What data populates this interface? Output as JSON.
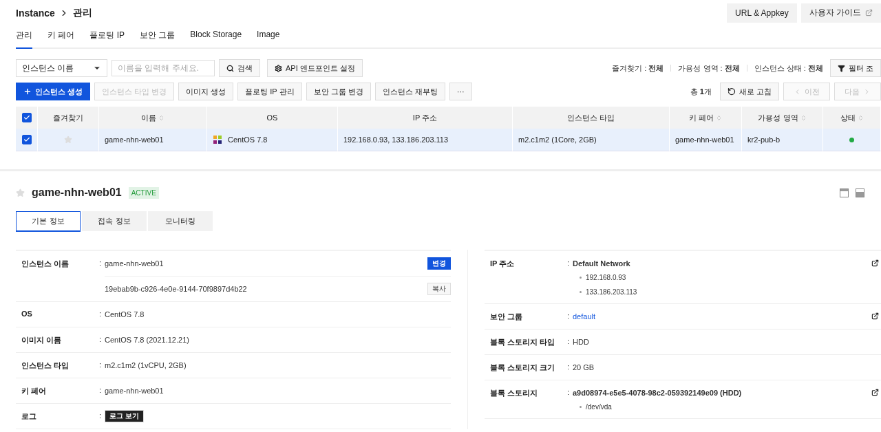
{
  "breadcrumb": [
    "Instance",
    "관리"
  ],
  "header_buttons": [
    {
      "label": "URL & Appkey",
      "external": false
    },
    {
      "label": "사용자 가이드",
      "external": true
    }
  ],
  "tabs": [
    {
      "label": "관리",
      "selected": true
    },
    {
      "label": "키 페어",
      "selected": false
    },
    {
      "label": "플로팅 IP",
      "selected": false
    },
    {
      "label": "보안 그룹",
      "selected": false
    },
    {
      "label": "Block Storage",
      "selected": false
    },
    {
      "label": "Image",
      "selected": false
    }
  ],
  "search": {
    "dropdown": "인스턴스 이름",
    "placeholder": "이름을 입력해 주세요.",
    "button": "검색",
    "api_button": "API 엔드포인트 설정"
  },
  "filters": [
    {
      "label": "즐겨찾기 :",
      "value": "전체"
    },
    {
      "label": "가용성 영역 :",
      "value": "전체"
    },
    {
      "label": "인스턴스 상태 :",
      "value": "전체"
    }
  ],
  "filter_button": "필터 조",
  "actions": [
    {
      "label": "인스턴스 생성",
      "kind": "primary"
    },
    {
      "label": "인스턴스 타입 변경",
      "kind": "disabled"
    },
    {
      "label": "이미지 생성",
      "kind": "normal"
    },
    {
      "label": "플로팅 IP 관리",
      "kind": "normal"
    },
    {
      "label": "보안 그룹 변경",
      "kind": "normal"
    },
    {
      "label": "인스턴스 재부팅",
      "kind": "normal"
    },
    {
      "label": "···",
      "kind": "normal"
    }
  ],
  "total": "총 **1**개",
  "refresh": "새로 고침",
  "pager": [
    {
      "label": "이전",
      "disabled": true,
      "kind": "prev"
    },
    {
      "label": "다음",
      "disabled": true,
      "kind": "next"
    }
  ],
  "table": {
    "all_checked": true,
    "columns": [
      {
        "label": "즐겨찾기",
        "sortable": false
      },
      {
        "label": "이름",
        "sortable": true
      },
      {
        "label": "OS",
        "sortable": false
      },
      {
        "label": "IP 주소",
        "sortable": false
      },
      {
        "label": "인스턴스 타입",
        "sortable": false
      },
      {
        "label": "키 페어",
        "sortable": true
      },
      {
        "label": "가용성 영역",
        "sortable": true
      },
      {
        "label": "상태",
        "sortable": true
      }
    ],
    "rows": [
      {
        "checked": true,
        "selected": true,
        "favorite": false,
        "name": "game-nhn-web01",
        "os": "CentOS 7.8",
        "ip": "192.168.0.93, 133.186.203.113",
        "type": "m2.c1m2 (1Core, 2GB)",
        "keypair": "game-nhn-web01",
        "zone": "kr2-pub-b",
        "color": "#22aa44"
      }
    ]
  },
  "detail": {
    "separator": ":",
    "favorite": false,
    "title": "game-nhn-web01",
    "status": "ACTIVE",
    "tabs": [
      {
        "label": "기본 정보",
        "selected": true
      },
      {
        "label": "접속 정보",
        "selected": false
      },
      {
        "label": "모니터링",
        "selected": false
      }
    ],
    "left": [
      {
        "label": "인스턴스 이름",
        "lines": [
          {
            "kind": "text",
            "value": "game-nhn-web01",
            "action": {
              "label": "변경",
              "kind": "primary"
            }
          },
          {
            "kind": "text",
            "value": "19ebab9b-c926-4e0e-9144-70f9897d4b22",
            "action": {
              "label": "복사",
              "kind": "secondary"
            }
          }
        ]
      },
      {
        "label": "OS",
        "lines": [
          {
            "kind": "text",
            "value": "CentOS 7.8"
          }
        ]
      },
      {
        "label": "이미지 이름",
        "lines": [
          {
            "kind": "text",
            "value": "CentOS 7.8 (2021.12.21)"
          }
        ]
      },
      {
        "label": "인스턴스 타입",
        "lines": [
          {
            "kind": "text",
            "value": "m2.c1m2 (1vCPU, 2GB)"
          }
        ]
      },
      {
        "label": "키 페어",
        "lines": [
          {
            "kind": "text",
            "value": "game-nhn-web01"
          }
        ]
      },
      {
        "label": "로그",
        "lines": [
          {
            "kind": "button",
            "value": "로그 보기"
          }
        ]
      }
    ],
    "right": [
      {
        "label": "IP 주소",
        "external": true,
        "lines": [
          {
            "kind": "bold",
            "value": "Default Network"
          }
        ],
        "bullets": [
          "192.168.0.93",
          "133.186.203.113"
        ]
      },
      {
        "label": "보안 그룹",
        "external": true,
        "lines": [
          {
            "kind": "link",
            "value": "default"
          }
        ]
      },
      {
        "label": "블록 스토리지 타입",
        "external": false,
        "lines": [
          {
            "kind": "text",
            "value": "HDD"
          }
        ]
      },
      {
        "label": "블록 스토리지 크기",
        "external": false,
        "lines": [
          {
            "kind": "text",
            "value": "20 GB"
          }
        ]
      },
      {
        "label": "블록 스토리지",
        "external": true,
        "lines": [
          {
            "kind": "bold",
            "value": "a9d08974-e5e5-4078-98c2-059392149e09 (HDD)"
          }
        ],
        "bullets": [
          "/dev/vda"
        ]
      }
    ]
  }
}
